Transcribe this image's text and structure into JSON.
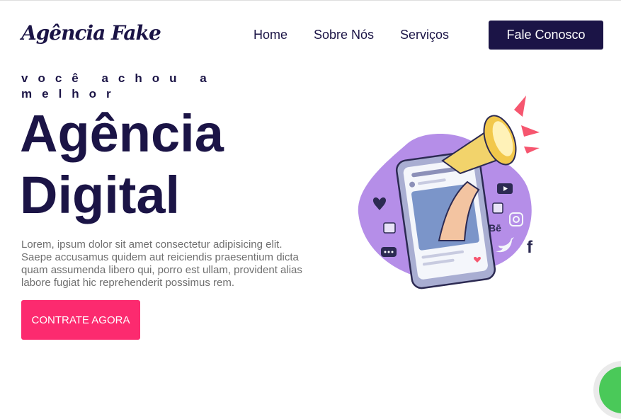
{
  "header": {
    "logo_text": "Agência Fake",
    "nav": [
      "Home",
      "Sobre Nós",
      "Serviços"
    ],
    "contact_button": "Fale Conosco"
  },
  "hero": {
    "tagline": "você achou a melhor",
    "title_line1": "Agência",
    "title_line2": "Digital",
    "description": "Lorem, ipsum dolor sit amet consectetur adipisicing elit. Saepe accusamus quidem aut reiciendis praesentium dicta quam assumenda libero qui, porro est ullam, provident alias labore fugiat hic reprehenderit possimus rem.",
    "cta_button": "CONTRATE AGORA"
  },
  "illustration": {
    "behance_label": "Bē",
    "facebook_label": "f"
  },
  "colors": {
    "primary": "#1b1446",
    "accent": "#fc2a6f",
    "blob": "#b58ee8",
    "whatsapp": "#4ac959"
  },
  "icons": [
    "megaphone-icon",
    "heart-icon",
    "like-icon",
    "chat-icon",
    "youtube-icon",
    "instagram-icon",
    "twitter-icon",
    "behance-icon",
    "facebook-icon",
    "whatsapp-icon"
  ]
}
